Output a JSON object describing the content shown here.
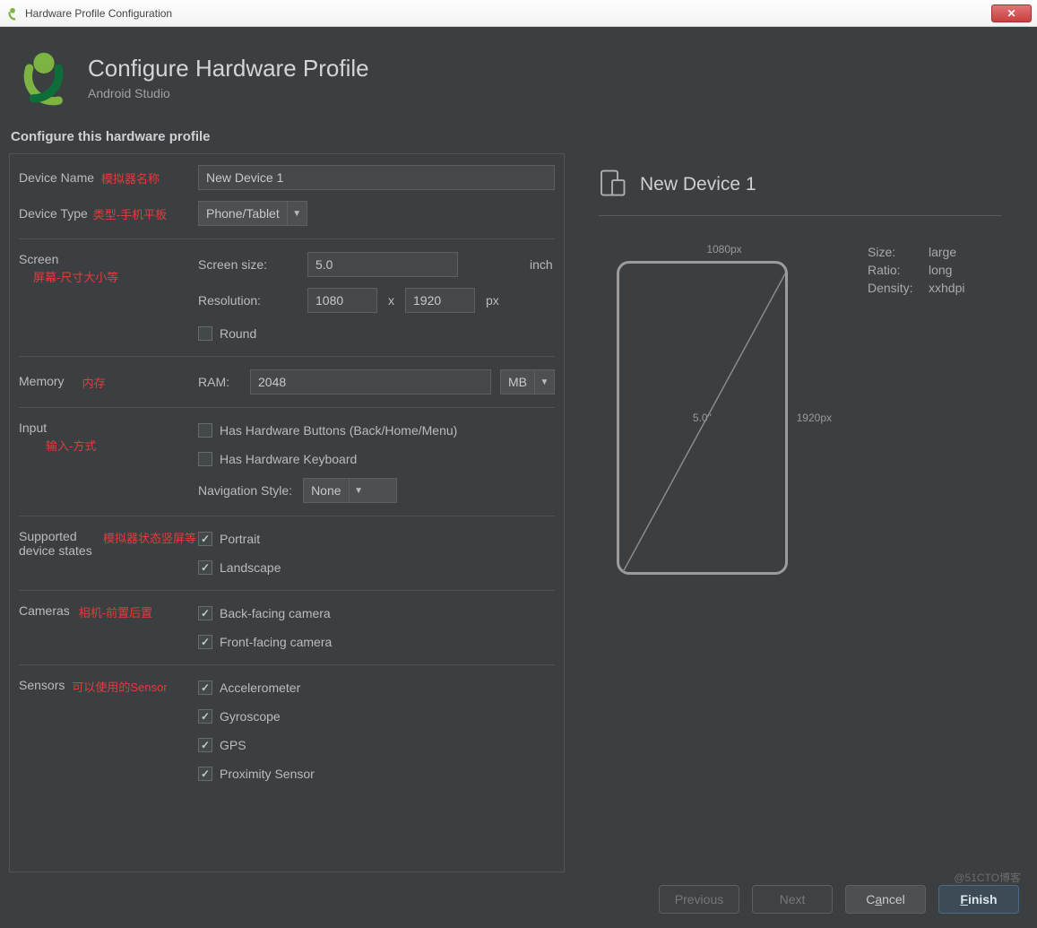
{
  "window": {
    "title": "Hardware Profile Configuration"
  },
  "header": {
    "title": "Configure Hardware Profile",
    "subtitle": "Android Studio"
  },
  "section_title": "Configure this hardware profile",
  "device_name": {
    "label": "Device Name",
    "annotation": "模拟器名称",
    "value": "New Device 1"
  },
  "device_type": {
    "label": "Device Type",
    "annotation": "类型-手机平板",
    "value": "Phone/Tablet"
  },
  "screen": {
    "label": "Screen",
    "annotation": "屏幕-尺寸大小等",
    "size_label": "Screen size:",
    "size_value": "5.0",
    "size_unit": "inch",
    "res_label": "Resolution:",
    "res_w": "1080",
    "res_x": "x",
    "res_h": "1920",
    "res_unit": "px",
    "round_label": "Round",
    "round_checked": false
  },
  "memory": {
    "label": "Memory",
    "annotation": "内存",
    "ram_label": "RAM:",
    "ram_value": "2048",
    "ram_unit": "MB"
  },
  "input": {
    "label": "Input",
    "annotation": "输入-方式",
    "hw_buttons_label": "Has Hardware Buttons (Back/Home/Menu)",
    "hw_buttons_checked": false,
    "hw_keyboard_label": "Has Hardware Keyboard",
    "hw_keyboard_checked": false,
    "nav_label": "Navigation Style:",
    "nav_value": "None"
  },
  "states": {
    "label": "Supported device states",
    "annotation": "模拟器状态竖屏等",
    "portrait_label": "Portrait",
    "portrait_checked": true,
    "landscape_label": "Landscape",
    "landscape_checked": true
  },
  "cameras": {
    "label": "Cameras",
    "annotation": "相机-前置后置",
    "back_label": "Back-facing camera",
    "back_checked": true,
    "front_label": "Front-facing camera",
    "front_checked": true
  },
  "sensors": {
    "label": "Sensors",
    "annotation": "可以使用的Sensor",
    "accel_label": "Accelerometer",
    "accel_checked": true,
    "gyro_label": "Gyroscope",
    "gyro_checked": true,
    "gps_label": "GPS",
    "gps_checked": true,
    "prox_label": "Proximity Sensor",
    "prox_checked": true
  },
  "preview": {
    "name": "New Device 1",
    "width_label": "1080px",
    "height_label": "1920px",
    "diag_label": "5.0\"",
    "props": {
      "size_k": "Size:",
      "size_v": "large",
      "ratio_k": "Ratio:",
      "ratio_v": "long",
      "density_k": "Density:",
      "density_v": "xxhdpi"
    }
  },
  "buttons": {
    "previous": "Previous",
    "next": "Next",
    "cancel_pre": "C",
    "cancel_ul": "a",
    "cancel_post": "ncel",
    "finish_pre": "",
    "finish_ul": "F",
    "finish_post": "inish"
  },
  "watermark": {
    "line1": "",
    "line2": "@51CTO博客"
  }
}
